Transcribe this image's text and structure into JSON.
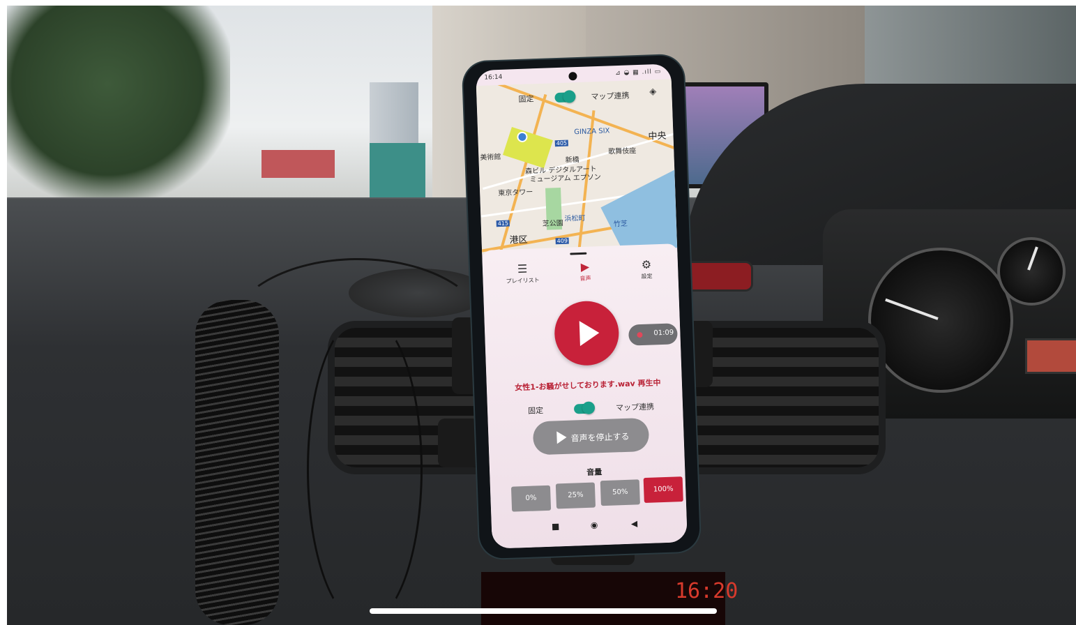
{
  "status_bar": {
    "time": "16:14",
    "icons": "⊿ ◒ ▦ .ıll ▭"
  },
  "map": {
    "top_toggle_left_label": "固定",
    "top_toggle_right_label": "マップ連携",
    "labels": {
      "ginza_six": "GINZA SIX",
      "chuo": "中央",
      "art_museum": "美術館",
      "kabukiza": "歌舞伎座",
      "shinbashi": "新橋",
      "mori_building": "森ビル デジタルアート",
      "museum_epson": "ミュージアム エプソン",
      "tokyo_tower": "東京タワー",
      "shiba_park": "芝公園",
      "hamamatsucho": "浜松町",
      "takeshiba": "竹芝",
      "minato": "港区",
      "route_415": "415",
      "route_409": "409",
      "route_405": "405"
    }
  },
  "tabs": [
    {
      "label": "プレイリスト",
      "icon": "list-icon"
    },
    {
      "label": "音声",
      "icon": "play-circle-icon"
    },
    {
      "label": "設定",
      "icon": "gear-icon"
    }
  ],
  "player": {
    "recording_time": "01:09",
    "now_playing": "女性1-お騒がせしております.wav 再生中",
    "toggle_left_label": "固定",
    "toggle_right_label": "マップ連携",
    "stop_label": "音声を停止する"
  },
  "volume": {
    "title": "音量",
    "options": [
      "0%",
      "25%",
      "50%",
      "100%"
    ],
    "selected": "100%"
  },
  "dashboard": {
    "radio_time": "16:20"
  },
  "colors": {
    "accent": "#c8213a",
    "toggle": "#1a9f8a",
    "button_gray": "#8d8c8f"
  }
}
